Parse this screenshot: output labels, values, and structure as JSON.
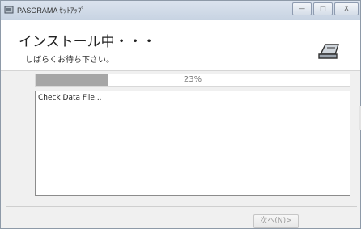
{
  "window": {
    "title": "PASORAMA ｾｯﾄｱｯﾌﾟ",
    "minimize_glyph": "—",
    "maximize_glyph": "□",
    "close_glyph": "X"
  },
  "header": {
    "title": "インストール中・・・",
    "subtitle": "しばらくお待ち下さい。",
    "icon": "card-reader-icon"
  },
  "progress": {
    "percent_text": "23%",
    "fraction": 0.23
  },
  "log": {
    "lines": [
      "Check Data File..."
    ]
  },
  "footer": {
    "next_label": "次へ(N)>"
  },
  "colors": {
    "progress_fill": "#a6a6a6",
    "header_bg": "#ffffff",
    "window_bg": "#f0f0f0"
  }
}
